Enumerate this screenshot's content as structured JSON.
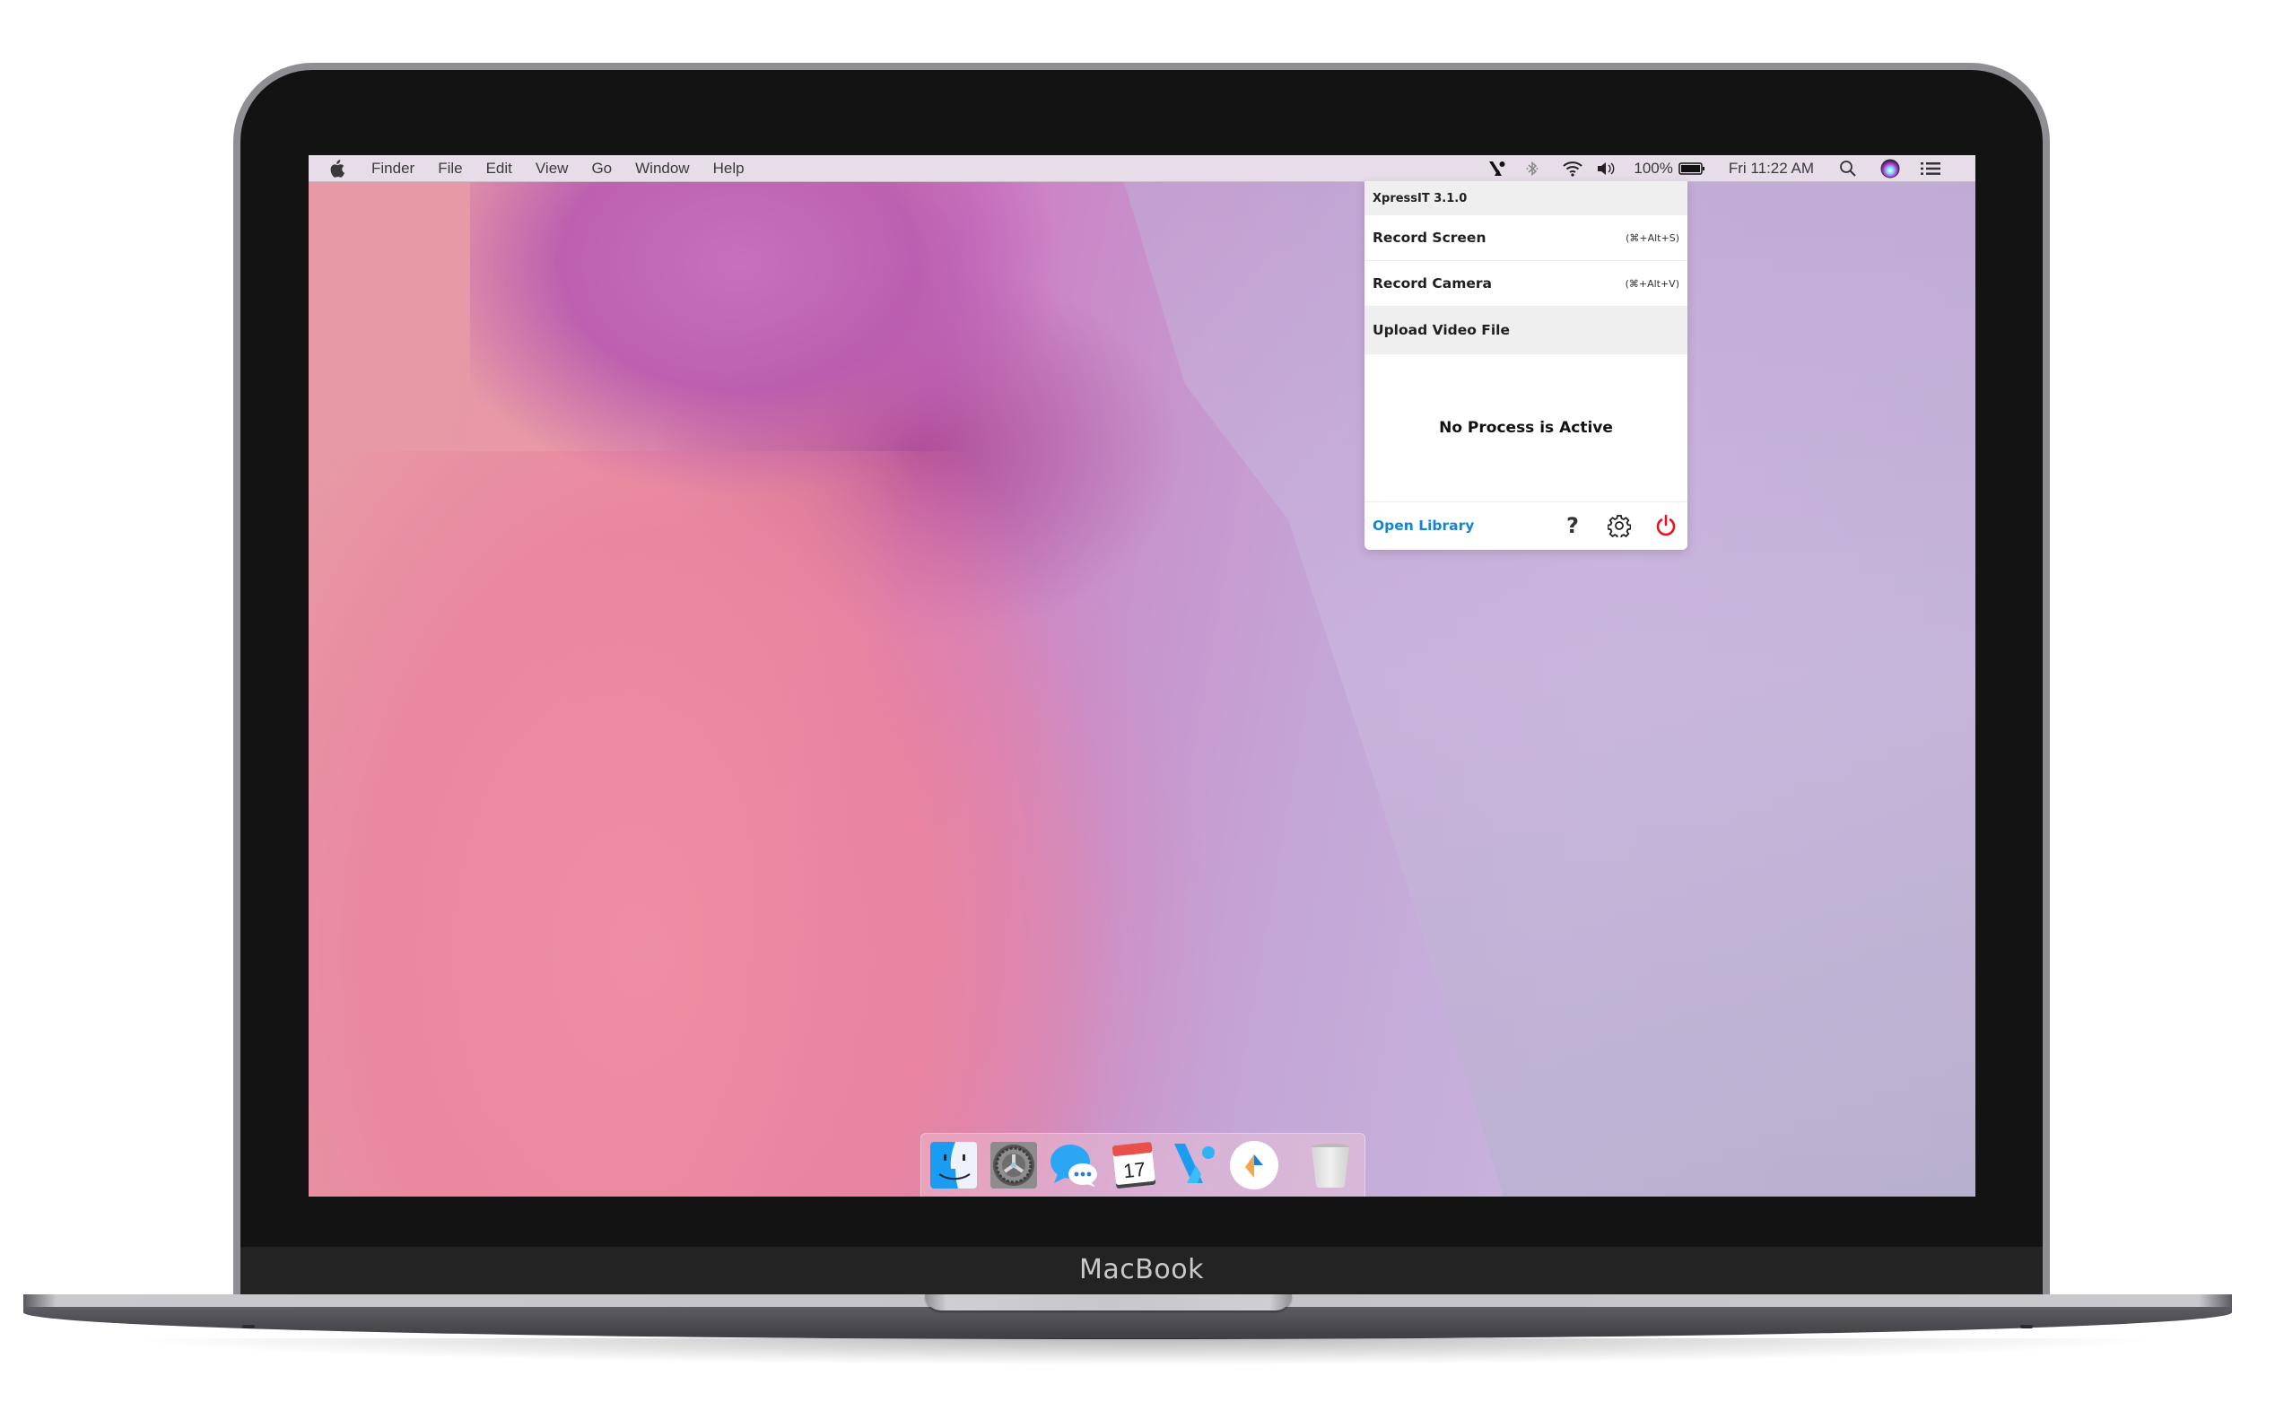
{
  "device": {
    "label": "MacBook"
  },
  "menubar": {
    "left_items": [
      "Finder",
      "File",
      "Edit",
      "View",
      "Go",
      "Window",
      "Help"
    ],
    "status_icons": [
      "xpressit-icon",
      "bluetooth-icon",
      "wifi-icon",
      "volume-icon"
    ],
    "battery_percent": "100%",
    "clock": "Fri 11:22 AM"
  },
  "popup": {
    "title": "XpressIT 3.1.0",
    "items": [
      {
        "label": "Record Screen",
        "shortcut": "(⌘+Alt+S)"
      },
      {
        "label": "Record Camera",
        "shortcut": "(⌘+Alt+V)"
      },
      {
        "label": "Upload Video File",
        "shortcut": ""
      }
    ],
    "status": "No Process is Active",
    "footer": {
      "open_library": "Open Library",
      "help_label": "?"
    },
    "colors": {
      "link": "#1583d6",
      "power": "#e8141c"
    }
  },
  "dock": {
    "apps": [
      {
        "name": "Finder",
        "icon": "finder-icon"
      },
      {
        "name": "System Preferences",
        "icon": "system-preferences-icon"
      },
      {
        "name": "Messages",
        "icon": "messages-icon"
      },
      {
        "name": "Calendar",
        "icon": "calendar-icon",
        "badge_text": "17"
      },
      {
        "name": "XpressIT",
        "icon": "xpressit-icon",
        "running": true
      },
      {
        "name": "Navigator",
        "icon": "navigator-icon"
      },
      {
        "name": "Trash",
        "icon": "trash-icon"
      }
    ]
  }
}
